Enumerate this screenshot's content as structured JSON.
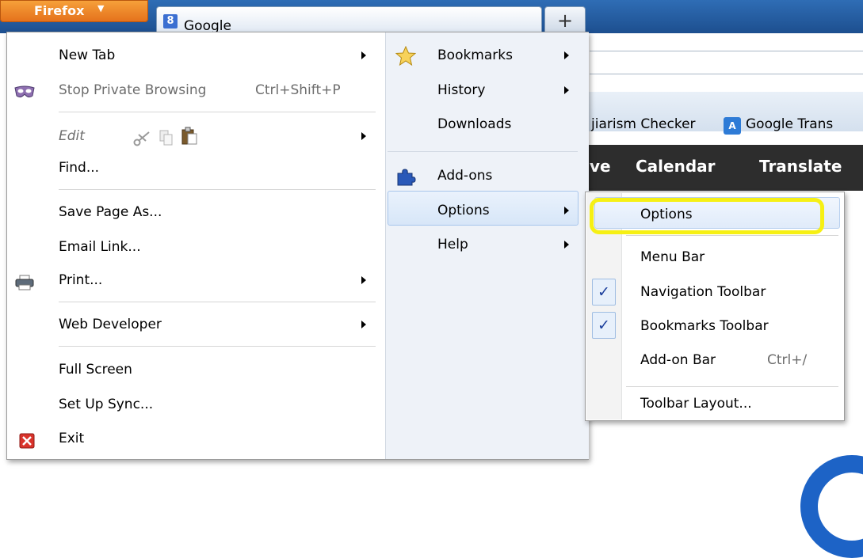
{
  "browser": {
    "app_button_label": "Firefox",
    "app_button_arrow": "▼",
    "tab_title": "Google",
    "tab_icon_letter": "8",
    "new_tab_label": "+"
  },
  "background": {
    "bookmarks": [
      "jiarism Checker",
      "Google Trans"
    ],
    "translate_icon_text": "A",
    "nav_links": [
      "ve",
      "Calendar",
      "Translate"
    ]
  },
  "menu": {
    "left_items": [
      {
        "label": "New Tab",
        "has_submenu": true,
        "icon": ""
      },
      {
        "label": "Stop Private Browsing",
        "shortcut": "Ctrl+Shift+P",
        "icon": "private-mask-icon"
      },
      {
        "label": "Edit",
        "has_submenu": true,
        "icon": "",
        "disabled": true
      },
      {
        "label": "Find...",
        "icon": ""
      },
      {
        "label": "Save Page As...",
        "icon": ""
      },
      {
        "label": "Email Link...",
        "icon": ""
      },
      {
        "label": "Print...",
        "has_submenu": true,
        "icon": "printer-icon"
      },
      {
        "label": "Web Developer",
        "has_submenu": true,
        "icon": ""
      },
      {
        "label": "Full Screen",
        "icon": ""
      },
      {
        "label": "Set Up Sync...",
        "icon": ""
      },
      {
        "label": "Exit",
        "icon": "exit-icon"
      }
    ],
    "edit_icons": [
      "cut-icon",
      "copy-icon",
      "paste-icon"
    ],
    "right_items": [
      {
        "label": "Bookmarks",
        "has_submenu": true,
        "icon": "star-icon"
      },
      {
        "label": "History",
        "has_submenu": true,
        "icon": ""
      },
      {
        "label": "Downloads",
        "icon": ""
      },
      {
        "label": "Add-ons",
        "icon": "puzzle-icon"
      },
      {
        "label": "Options",
        "has_submenu": true,
        "icon": "",
        "hovered": true
      },
      {
        "label": "Help",
        "has_submenu": true,
        "icon": ""
      }
    ]
  },
  "options_submenu": {
    "items": [
      {
        "label": "Options",
        "checked": false,
        "highlighted": true
      },
      {
        "label": "Menu Bar",
        "checked": false
      },
      {
        "label": "Navigation Toolbar",
        "checked": true
      },
      {
        "label": "Bookmarks Toolbar",
        "checked": true
      },
      {
        "label": "Add-on Bar",
        "shortcut": "Ctrl+/",
        "checked": false
      },
      {
        "label": "Toolbar Layout...",
        "checked": false
      }
    ],
    "check_glyph": "✓"
  },
  "colors": {
    "firefox_orange": "#e4701b",
    "highlight_yellow": "#f6f014",
    "title_bar_blue": "#2f6db5"
  }
}
